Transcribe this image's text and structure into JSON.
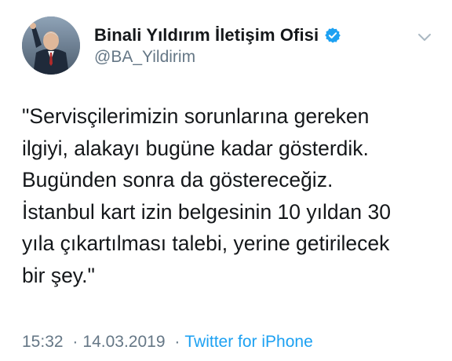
{
  "account": {
    "display_name": "Binali Yıldırım İletişim Ofisi",
    "handle": "@BA_Yildirim",
    "verified_icon": "verified-badge-icon",
    "verified_color": "#1da1f2"
  },
  "tweet": {
    "text": "\"Servisçilerimizin sorunlarına gereken\nilgiyi, alakayı bugüne kadar gösterdik.\nBugünden sonra da göstereceğiz.\nİstanbul kart izin belgesinin 10 yıldan 30\nyıla çıkartılması talebi, yerine getirilecek\nbir şey.\""
  },
  "meta": {
    "time": "15:32",
    "separator": "·",
    "date": "14.03.2019",
    "source": "Twitter for iPhone"
  },
  "icons": {
    "menu": "chevron-down-icon"
  },
  "colors": {
    "text": "#14171a",
    "secondary": "#657786",
    "link": "#1da1f2"
  }
}
